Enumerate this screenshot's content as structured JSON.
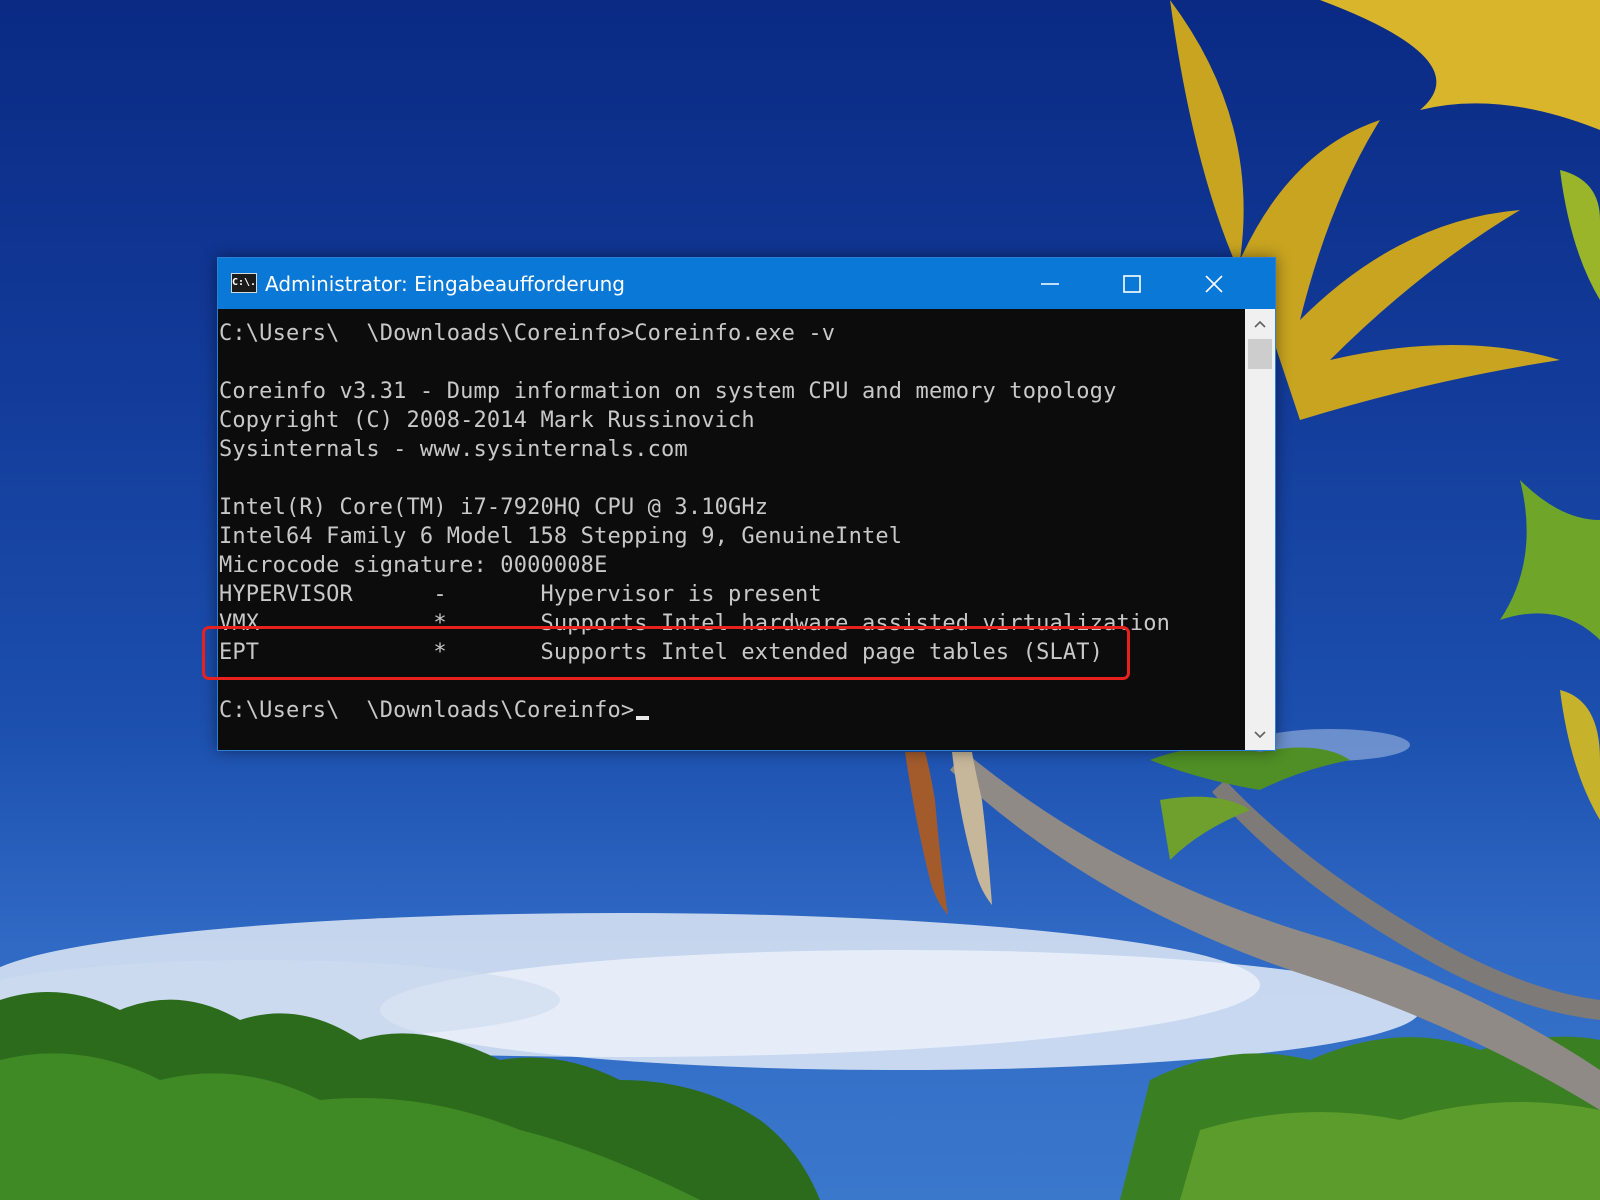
{
  "window": {
    "icon_text": "C:\\.",
    "title": "Administrator: Eingabeaufforderung"
  },
  "console": {
    "lines": [
      "C:\\Users\\  \\Downloads\\Coreinfo>Coreinfo.exe -v",
      "",
      "Coreinfo v3.31 - Dump information on system CPU and memory topology",
      "Copyright (C) 2008-2014 Mark Russinovich",
      "Sysinternals - www.sysinternals.com",
      "",
      "Intel(R) Core(TM) i7-7920HQ CPU @ 3.10GHz",
      "Intel64 Family 6 Model 158 Stepping 9, GenuineIntel",
      "Microcode signature: 0000008E",
      "HYPERVISOR      -       Hypervisor is present",
      "VMX             *       Supports Intel hardware assisted virtualization",
      "EPT             *       Supports Intel extended page tables (SLAT)",
      "",
      "C:\\Users\\  \\Downloads\\Coreinfo>"
    ],
    "highlighted_line": "EPT             *       Supports Intel extended page tables (SLAT)"
  },
  "scrollbar": {
    "position": 0.0
  },
  "colors": {
    "titlebar": "#0a78d7",
    "console_background": "#0c0c0c",
    "console_text": "#c8c8c8",
    "highlight_border": "#e8201e"
  },
  "icons": [
    "console-app-icon",
    "minimize-icon",
    "maximize-icon",
    "close-icon",
    "scroll-up-arrow-icon",
    "scroll-down-arrow-icon"
  ]
}
